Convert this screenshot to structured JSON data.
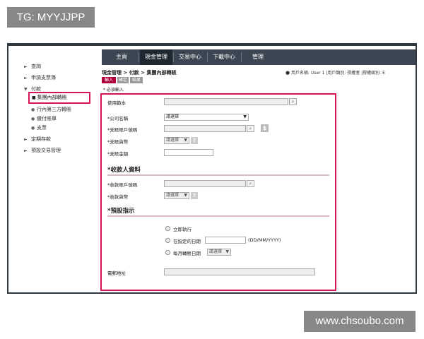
{
  "watermarks": {
    "top": "TG: MYYJJPP",
    "bottom": "www.chsoubo.com"
  },
  "nav": {
    "tabs": [
      "主頁",
      "現金管理",
      "交易中心",
      "下載中心",
      "管理"
    ],
    "active_tab": "現金管理"
  },
  "sidebar": {
    "items": [
      "查詢",
      "申請支票簿",
      "付款",
      "定期存款",
      "預設交易管理"
    ],
    "payment_sub": [
      "集團內部轉賬",
      "行內第三方轉賬",
      "繳付賬單",
      "支票"
    ]
  },
  "breadcrumb": "現金管理 > 付款 > 集團內部轉賬",
  "user": {
    "name_label": "用戶名稱: User 1",
    "type_label": "|用戶類別: 授權者 |授權級別: E"
  },
  "steps": [
    "輸入",
    "確定",
    "結果"
  ],
  "required_note": "* 必須輸入",
  "form": {
    "template_label": "使用範本",
    "company_label": "*公司名稱",
    "company_value": "請選擇",
    "debit_account_label": "*支賬賬戶號碼",
    "debit_currency_label": "*支賬貨幣",
    "debit_currency_value": "請選擇",
    "debit_amount_label": "*支賬金額",
    "payee_section": "*收款人資料",
    "payee_account_label": "*收款賬戶號碼",
    "payee_currency_label": "*收款貨幣",
    "payee_currency_value": "請選擇",
    "schedule_section": "*預設指示",
    "opt_immediate": "立即執行",
    "opt_date": "在指定的日期",
    "date_format": "(DD/MM/YYYY)",
    "opt_monthly": "每月轉賬日期",
    "monthly_value": "請選擇",
    "email_label": "電郵地址"
  },
  "icons": {
    "search": "magnifier-icon",
    "currency": "dollar-icon",
    "help": "question-icon"
  },
  "colors": {
    "accent": "#d4145a",
    "nav_bg": "#3c4652",
    "step_active": "#b0003a"
  }
}
